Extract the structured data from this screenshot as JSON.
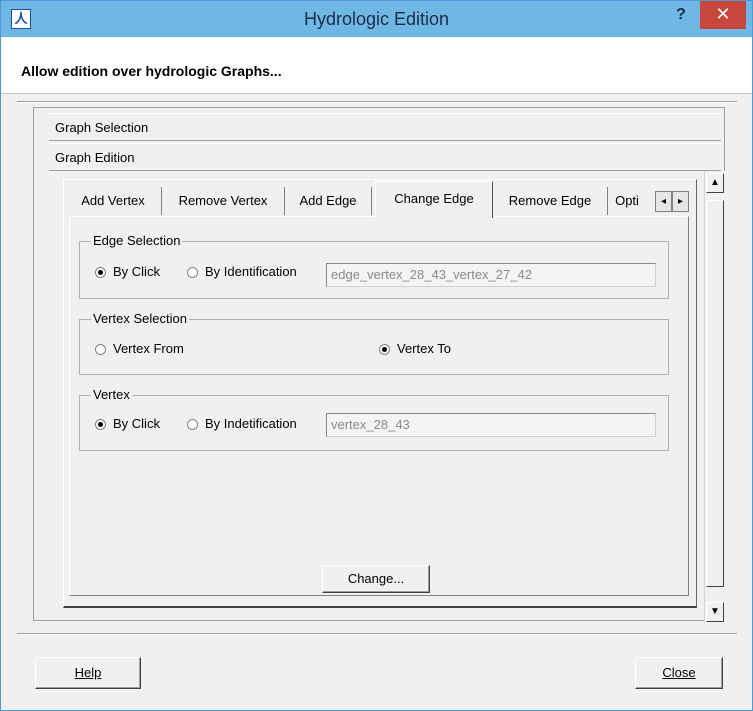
{
  "window": {
    "title": "Hydrologic Edition",
    "help_glyph": "?",
    "close_glyph": "✕",
    "app_icon_glyph": "人"
  },
  "header": {
    "text": "Allow edition over hydrologic Graphs..."
  },
  "accordion": {
    "graph_selection": "Graph Selection",
    "graph_edition": "Graph Edition"
  },
  "tabs": [
    {
      "label": "Add Vertex",
      "active": false
    },
    {
      "label": "Remove Vertex",
      "active": false
    },
    {
      "label": "Add Edge",
      "active": false
    },
    {
      "label": "Change Edge",
      "active": true
    },
    {
      "label": "Remove Edge",
      "active": false
    },
    {
      "label": "Opti",
      "active": false
    }
  ],
  "tab_scroll": {
    "left_glyph": "◂",
    "right_glyph": "▸"
  },
  "edge_selection": {
    "title": "Edge Selection",
    "by_click": "By Click",
    "by_identification": "By Identification",
    "selected": "by_click",
    "value": "edge_vertex_28_43_vertex_27_42"
  },
  "vertex_selection": {
    "title": "Vertex Selection",
    "vertex_from": "Vertex From",
    "vertex_to": "Vertex To",
    "selected": "vertex_to"
  },
  "vertex": {
    "title": "Vertex",
    "by_click": "By Click",
    "by_identification": "By Indetification",
    "selected": "by_click",
    "value": "vertex_28_43"
  },
  "buttons": {
    "change": "Change...",
    "help": "Help",
    "close": "Close"
  },
  "scrollbar": {
    "up_glyph": "▲",
    "down_glyph": "▼"
  },
  "colors": {
    "titlebar": "#6fb8e6",
    "close_button": "#c9463d",
    "window_bg": "#f0f0f0"
  }
}
